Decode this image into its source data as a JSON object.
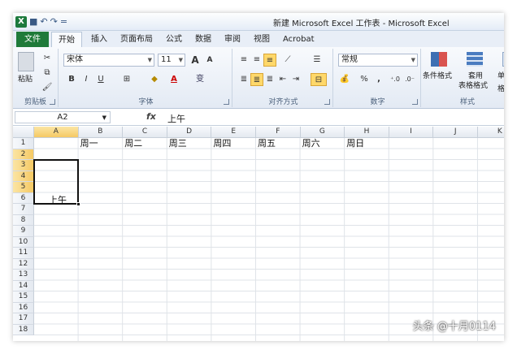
{
  "title": "新建 Microsoft Excel 工作表 - Microsoft Excel",
  "logo": "X",
  "qat": {
    "save": "■",
    "undo": "↶",
    "redo": "↷",
    "customize": "="
  },
  "tabs": [
    {
      "label": "文件"
    },
    {
      "label": "开始"
    },
    {
      "label": "插入"
    },
    {
      "label": "页面布局"
    },
    {
      "label": "公式"
    },
    {
      "label": "数据"
    },
    {
      "label": "审阅"
    },
    {
      "label": "视图"
    },
    {
      "label": "Acrobat"
    }
  ],
  "ribbon": {
    "clipboard": {
      "label": "剪贴板",
      "paste": "粘贴"
    },
    "font": {
      "label": "字体",
      "font_name": "宋体",
      "font_size": "11",
      "grow": "A",
      "shrink": "A",
      "bold": "B",
      "italic": "I",
      "underline": "U",
      "wen": "变"
    },
    "alignment": {
      "label": "对齐方式"
    },
    "number": {
      "label": "数字",
      "format": "常规",
      "percent": "%",
      "comma": ","
    },
    "styles": {
      "label": "样式",
      "conditional": "条件格式",
      "table_format_1": "套用",
      "table_format_2": "表格格式",
      "cell_styles": "单元格"
    }
  },
  "formula_bar": {
    "name_box": "A2",
    "fx": "fx",
    "value": "上午"
  },
  "columns": [
    "A",
    "B",
    "C",
    "D",
    "E",
    "F",
    "G",
    "H",
    "I",
    "J",
    "K"
  ],
  "rows": [
    "1",
    "2",
    "3",
    "4",
    "5",
    "6",
    "7",
    "8",
    "9",
    "10",
    "11",
    "12",
    "13",
    "14",
    "15",
    "16",
    "17",
    "18"
  ],
  "selected_column": "A",
  "selected_rows": [
    "2",
    "3",
    "4",
    "5"
  ],
  "row1": [
    "周一",
    "周二",
    "周三",
    "周四",
    "周五",
    "周六",
    "周日"
  ],
  "merged_cell_text": "上午",
  "watermark": "头条 @十月0114",
  "colors": {
    "file_tab": "#1f7a3a",
    "selection_header": "#f5c964",
    "active_button": "#ffd86a"
  }
}
